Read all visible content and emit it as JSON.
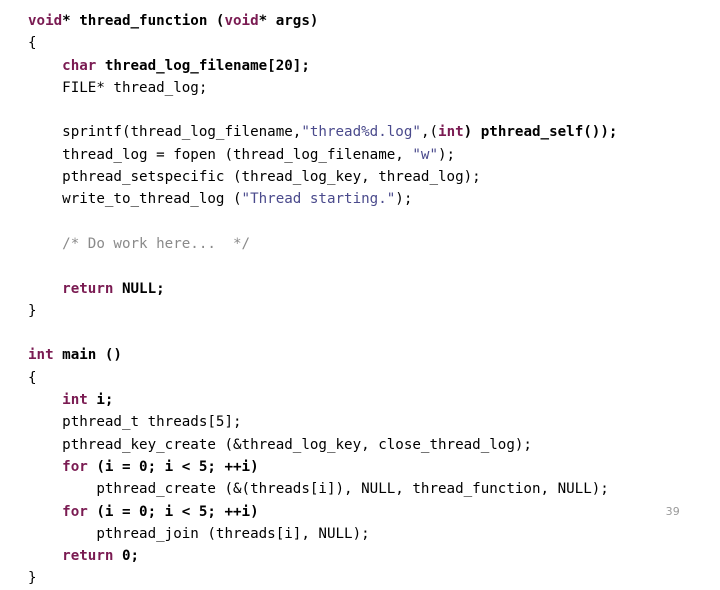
{
  "slide": {
    "page_number": "39",
    "colors": {
      "background": "#ffffff",
      "keyword": "#7a1b52",
      "string": "#4a4a8c",
      "comment": "#8a8a8a",
      "code": "#000000",
      "page_number": "#9a9a9a"
    }
  },
  "code": {
    "language": "c",
    "lines": [
      {
        "id": "line-1",
        "tokens": [
          {
            "text": "void",
            "style": "kw"
          },
          {
            "text": "* thread_function (",
            "style": "bold"
          },
          {
            "text": "void",
            "style": "kw"
          },
          {
            "text": "* args)",
            "style": "bold"
          }
        ]
      },
      {
        "id": "line-2",
        "tokens": [
          {
            "text": "{",
            "style": "plain"
          }
        ]
      },
      {
        "id": "line-3",
        "tokens": [
          {
            "text": "    ",
            "style": "plain"
          },
          {
            "text": "char",
            "style": "kw"
          },
          {
            "text": " thread_log_filename[20];",
            "style": "bold"
          }
        ]
      },
      {
        "id": "line-4",
        "tokens": [
          {
            "text": "    FILE* thread_log;",
            "style": "plain"
          }
        ]
      },
      {
        "id": "line-5",
        "tokens": [
          {
            "text": " ",
            "style": "plain"
          }
        ]
      },
      {
        "id": "line-6",
        "tokens": [
          {
            "text": "    sprintf(thread_log_filename,",
            "style": "plain"
          },
          {
            "text": "\"thread%d.log\"",
            "style": "str"
          },
          {
            "text": ",(",
            "style": "plain"
          },
          {
            "text": "int",
            "style": "kw"
          },
          {
            "text": ") pthread_self());",
            "style": "bold"
          }
        ]
      },
      {
        "id": "line-7",
        "tokens": [
          {
            "text": "    thread_log = fopen (thread_log_filename, ",
            "style": "plain"
          },
          {
            "text": "\"w\"",
            "style": "str"
          },
          {
            "text": ");",
            "style": "plain"
          }
        ]
      },
      {
        "id": "line-8",
        "tokens": [
          {
            "text": "    pthread_setspecific (thread_log_key, thread_log);",
            "style": "plain"
          }
        ]
      },
      {
        "id": "line-9",
        "tokens": [
          {
            "text": "    write_to_thread_log (",
            "style": "plain"
          },
          {
            "text": "\"Thread starting.\"",
            "style": "str"
          },
          {
            "text": ");",
            "style": "plain"
          }
        ]
      },
      {
        "id": "line-10",
        "tokens": [
          {
            "text": " ",
            "style": "plain"
          }
        ]
      },
      {
        "id": "line-11",
        "tokens": [
          {
            "text": "    ",
            "style": "plain"
          },
          {
            "text": "/* Do work here...  */",
            "style": "comment"
          }
        ]
      },
      {
        "id": "line-12",
        "tokens": [
          {
            "text": " ",
            "style": "plain"
          }
        ]
      },
      {
        "id": "line-13",
        "tokens": [
          {
            "text": "    ",
            "style": "plain"
          },
          {
            "text": "return",
            "style": "kw"
          },
          {
            "text": " NULL;",
            "style": "bold"
          }
        ]
      },
      {
        "id": "line-14",
        "tokens": [
          {
            "text": "}",
            "style": "plain"
          }
        ]
      },
      {
        "id": "line-15",
        "tokens": [
          {
            "text": " ",
            "style": "plain"
          }
        ]
      },
      {
        "id": "line-16",
        "tokens": [
          {
            "text": "int",
            "style": "kw"
          },
          {
            "text": " main ()",
            "style": "bold"
          }
        ]
      },
      {
        "id": "line-17",
        "tokens": [
          {
            "text": "{",
            "style": "plain"
          }
        ]
      },
      {
        "id": "line-18",
        "tokens": [
          {
            "text": "    ",
            "style": "plain"
          },
          {
            "text": "int",
            "style": "kw"
          },
          {
            "text": " i;",
            "style": "bold"
          }
        ]
      },
      {
        "id": "line-19",
        "tokens": [
          {
            "text": "    pthread_t threads[5];",
            "style": "plain"
          }
        ]
      },
      {
        "id": "line-20",
        "tokens": [
          {
            "text": "    pthread_key_create (&thread_log_key, close_thread_log);",
            "style": "plain"
          }
        ]
      },
      {
        "id": "line-21",
        "tokens": [
          {
            "text": "    ",
            "style": "plain"
          },
          {
            "text": "for",
            "style": "kw"
          },
          {
            "text": " (i = 0; i < 5; ++i)",
            "style": "bold"
          }
        ]
      },
      {
        "id": "line-22",
        "tokens": [
          {
            "text": "        pthread_create (&(threads[i]), NULL, thread_function, NULL);",
            "style": "plain"
          }
        ]
      },
      {
        "id": "line-23",
        "tokens": [
          {
            "text": "    ",
            "style": "plain"
          },
          {
            "text": "for",
            "style": "kw"
          },
          {
            "text": " (i = 0; i < 5; ++i)",
            "style": "bold"
          }
        ]
      },
      {
        "id": "line-24",
        "tokens": [
          {
            "text": "        pthread_join (threads[i], NULL);",
            "style": "plain"
          }
        ]
      },
      {
        "id": "line-25",
        "tokens": [
          {
            "text": "    ",
            "style": "plain"
          },
          {
            "text": "return",
            "style": "kw"
          },
          {
            "text": " 0;",
            "style": "bold"
          }
        ]
      },
      {
        "id": "line-26",
        "tokens": [
          {
            "text": "}",
            "style": "plain"
          }
        ]
      }
    ]
  }
}
